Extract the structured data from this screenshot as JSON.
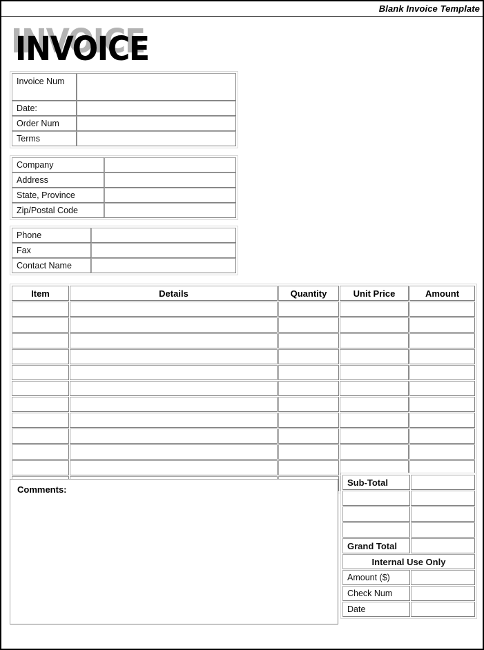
{
  "header": {
    "title": "Blank Invoice Template"
  },
  "wordmark": {
    "text": "INVOICE",
    "shadow_text": "INVOICE",
    "shadow_color": "#b3b3b3",
    "text_color": "#000000"
  },
  "invoice_meta": {
    "rows": [
      {
        "label": "Invoice Num",
        "value": ""
      },
      {
        "label": "Date:",
        "value": ""
      },
      {
        "label": "Order Num",
        "value": ""
      },
      {
        "label": "Terms",
        "value": ""
      }
    ]
  },
  "company": {
    "rows": [
      {
        "label": "Company",
        "value": ""
      },
      {
        "label": "Address",
        "value": ""
      },
      {
        "label": "State, Province",
        "value": ""
      },
      {
        "label": "Zip/Postal Code",
        "value": ""
      }
    ]
  },
  "contact": {
    "rows": [
      {
        "label": "Phone",
        "value": ""
      },
      {
        "label": "Fax",
        "value": ""
      },
      {
        "label": "Contact Name",
        "value": ""
      }
    ]
  },
  "line_items": {
    "columns": [
      "Item",
      "Details",
      "Quantity",
      "Unit Price",
      "Amount"
    ],
    "rows": [
      {
        "item": "",
        "details": "",
        "quantity": "",
        "unit_price": "",
        "amount": ""
      },
      {
        "item": "",
        "details": "",
        "quantity": "",
        "unit_price": "",
        "amount": ""
      },
      {
        "item": "",
        "details": "",
        "quantity": "",
        "unit_price": "",
        "amount": ""
      },
      {
        "item": "",
        "details": "",
        "quantity": "",
        "unit_price": "",
        "amount": ""
      },
      {
        "item": "",
        "details": "",
        "quantity": "",
        "unit_price": "",
        "amount": ""
      },
      {
        "item": "",
        "details": "",
        "quantity": "",
        "unit_price": "",
        "amount": ""
      },
      {
        "item": "",
        "details": "",
        "quantity": "",
        "unit_price": "",
        "amount": ""
      },
      {
        "item": "",
        "details": "",
        "quantity": "",
        "unit_price": "",
        "amount": ""
      },
      {
        "item": "",
        "details": "",
        "quantity": "",
        "unit_price": "",
        "amount": ""
      },
      {
        "item": "",
        "details": "",
        "quantity": "",
        "unit_price": "",
        "amount": ""
      },
      {
        "item": "",
        "details": "",
        "quantity": "",
        "unit_price": "",
        "amount": ""
      },
      {
        "item": "",
        "details": "",
        "quantity": "",
        "unit_price": "",
        "amount": ""
      }
    ]
  },
  "comments": {
    "label": "Comments:",
    "value": ""
  },
  "totals": {
    "rows": [
      {
        "label": "Sub-Total",
        "value": "",
        "bold": true
      },
      {
        "label": "",
        "value": "",
        "bold": false
      },
      {
        "label": "",
        "value": "",
        "bold": false
      },
      {
        "label": "",
        "value": "",
        "bold": false
      },
      {
        "label": "Grand Total",
        "value": "",
        "bold": true
      }
    ],
    "internal_heading": "Internal Use Only",
    "internal_rows": [
      {
        "label": "Amount ($)",
        "value": ""
      },
      {
        "label": "Check Num",
        "value": ""
      },
      {
        "label": "Date",
        "value": ""
      }
    ]
  },
  "colors": {
    "page_border": "#000000",
    "cell_border": "#a6a6a6",
    "cell_border_dark": "#808080",
    "block_border": "#d9d9d9",
    "text": "#111111"
  }
}
